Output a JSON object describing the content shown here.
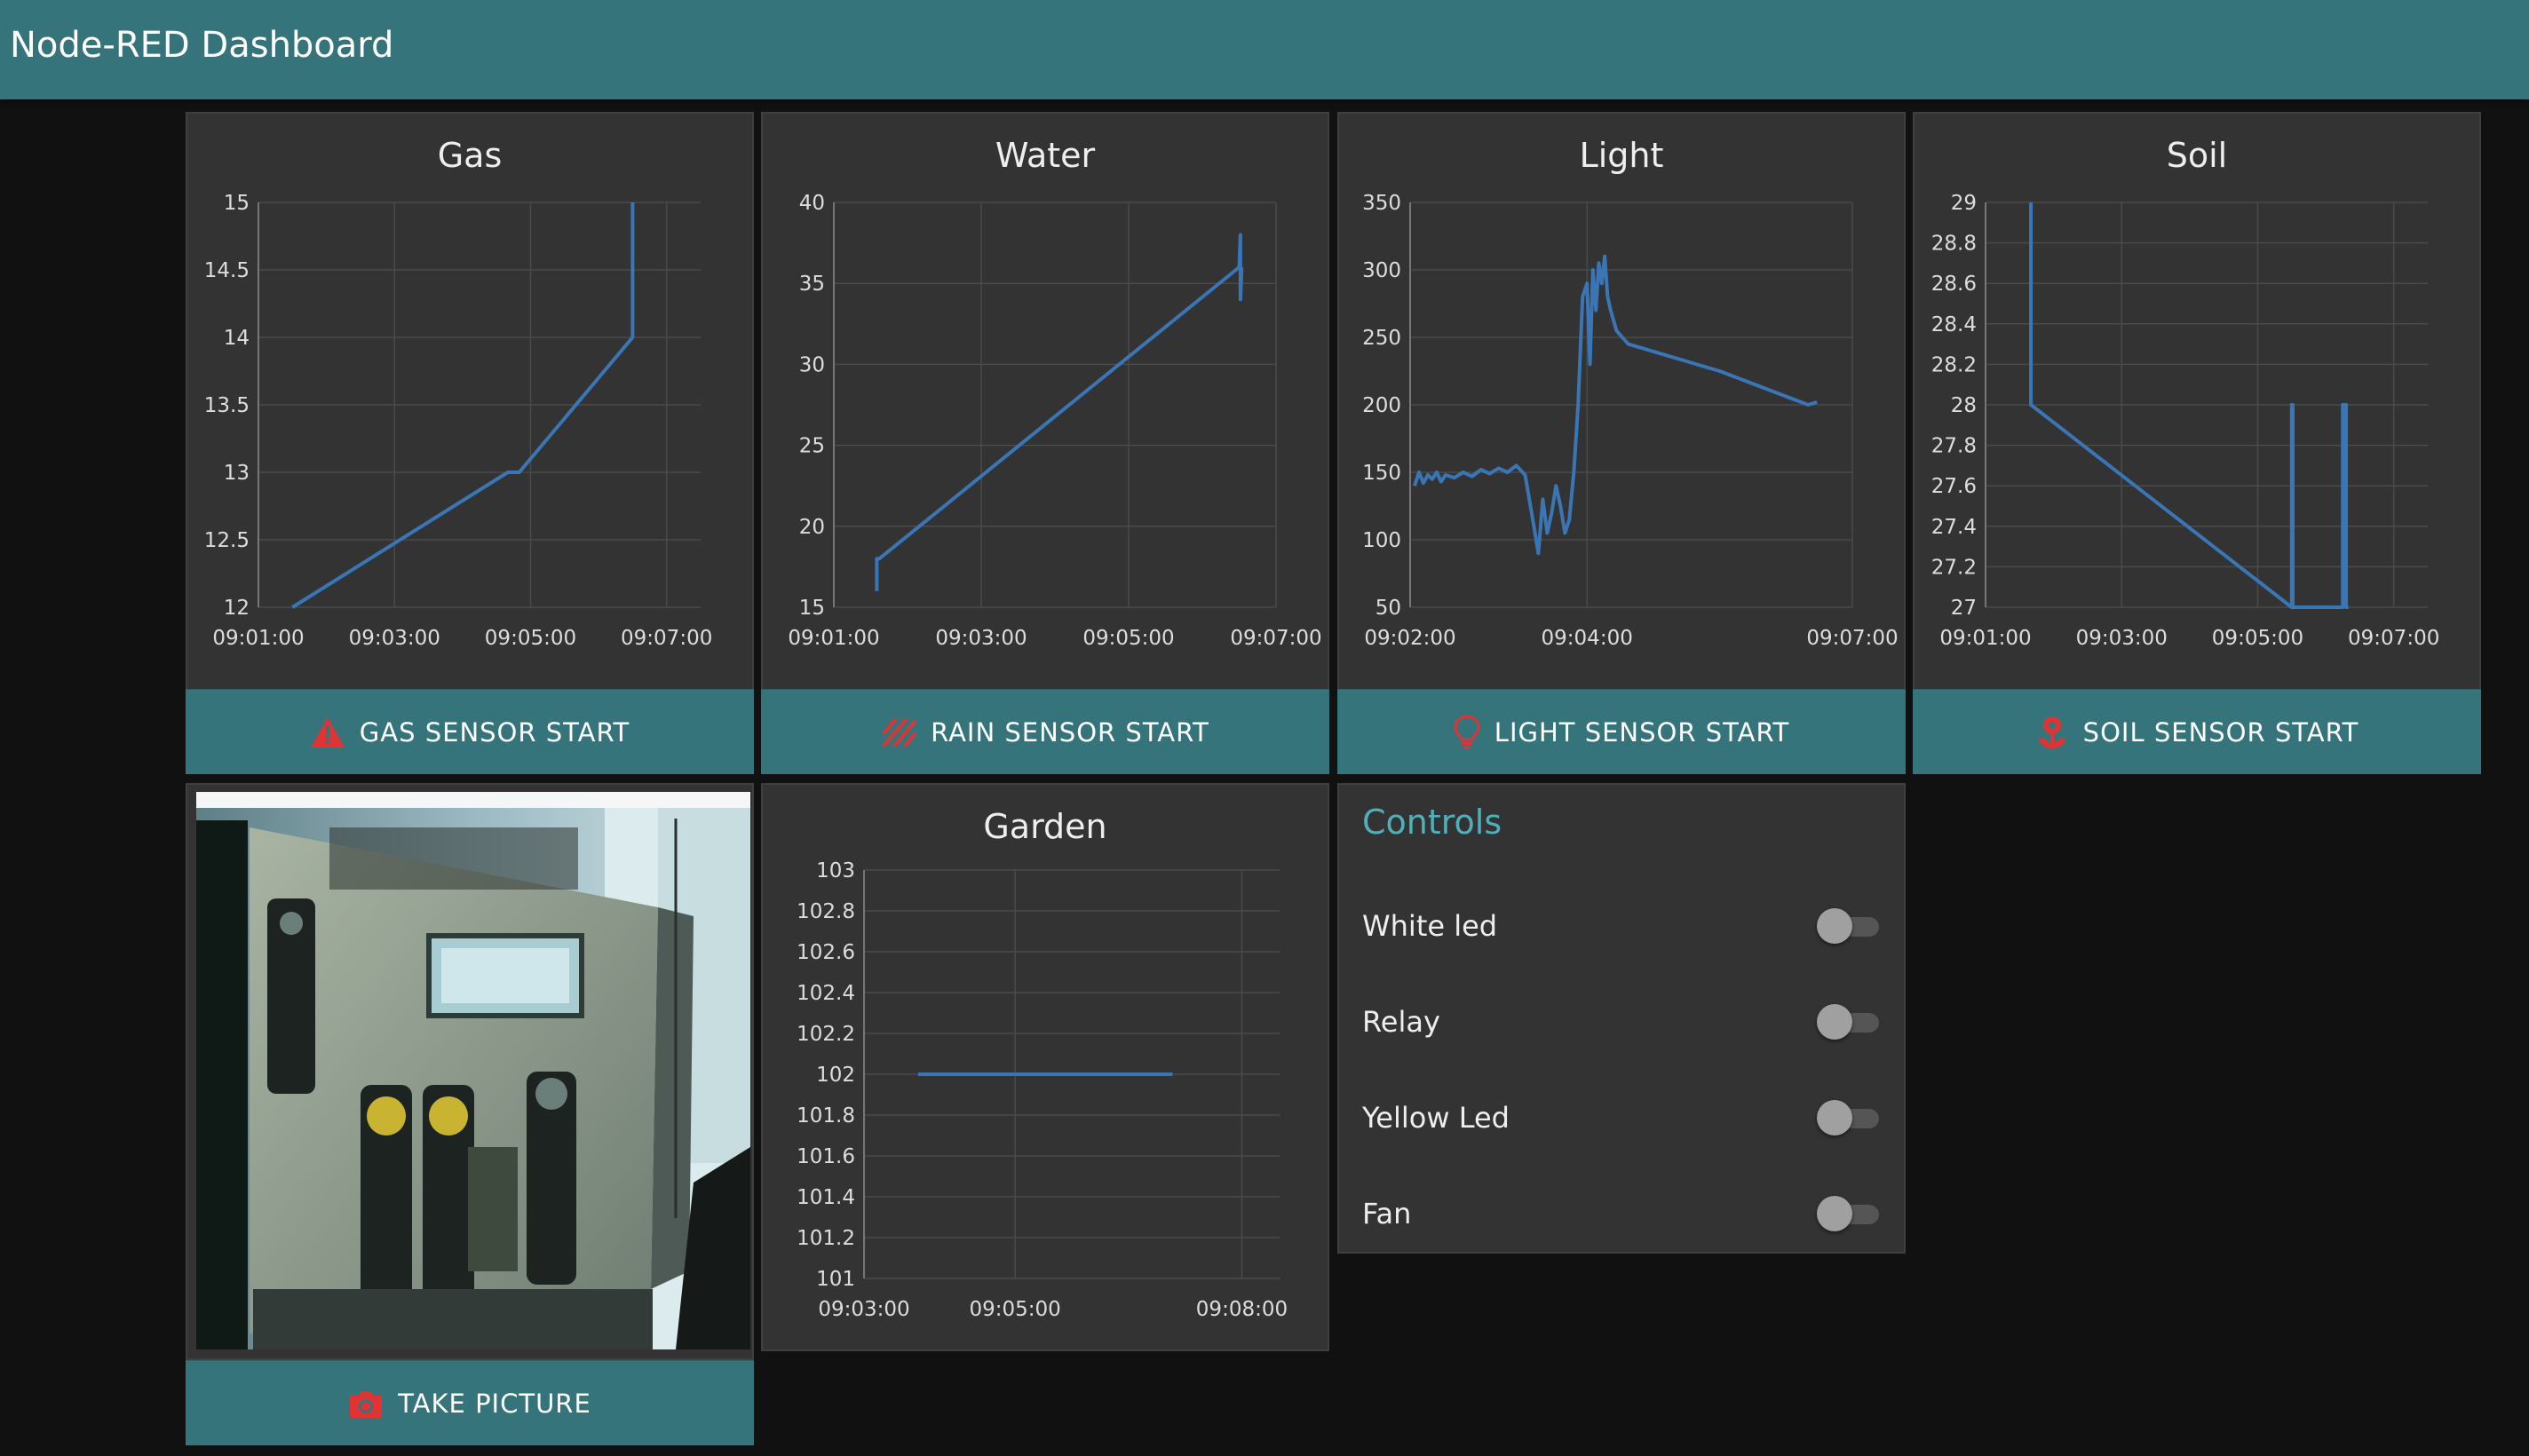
{
  "app": {
    "title": "Node-RED Dashboard"
  },
  "colors": {
    "header": "#35747b",
    "series": "#3a76b5",
    "accent_text": "#4fb0bb",
    "icon_red": "#e03434"
  },
  "buttons": {
    "gas": {
      "label": "GAS SENSOR START",
      "icon": "warning-triangle-icon"
    },
    "rain": {
      "label": "RAIN SENSOR START",
      "icon": "rain-icon"
    },
    "light": {
      "label": "LIGHT SENSOR START",
      "icon": "lightbulb-icon"
    },
    "soil": {
      "label": "SOIL SENSOR START",
      "icon": "plant-icon"
    },
    "picture": {
      "label": "TAKE PICTURE",
      "icon": "camera-icon"
    }
  },
  "camera": {
    "description_icon": "camera-image"
  },
  "controls": {
    "title": "Controls",
    "items": [
      {
        "label": "White led",
        "state": "off"
      },
      {
        "label": "Relay",
        "state": "off"
      },
      {
        "label": "Yellow Led",
        "state": "off"
      },
      {
        "label": "Fan",
        "state": "off"
      }
    ]
  },
  "chart_data": [
    {
      "id": "gas",
      "type": "line",
      "title": "Gas",
      "xlim": [
        "09:01:00",
        "09:07:30"
      ],
      "ylim": [
        12,
        15
      ],
      "x_ticks": [
        "09:01:00",
        "09:03:00",
        "09:05:00",
        "09:07:00"
      ],
      "y_ticks": [
        "15",
        "14.5",
        "14",
        "13.5",
        "13",
        "12.5",
        "12"
      ],
      "grid": true,
      "series": [
        {
          "x": [
            "09:01:30",
            "09:04:40",
            "09:04:50",
            "09:06:30",
            "09:06:30"
          ],
          "y": [
            12,
            13,
            13,
            14,
            15
          ]
        }
      ]
    },
    {
      "id": "water",
      "type": "line",
      "title": "Water",
      "xlim": [
        "09:01:00",
        "09:07:00"
      ],
      "ylim": [
        15,
        40
      ],
      "x_ticks": [
        "09:01:00",
        "09:03:00",
        "09:05:00",
        "09:07:00"
      ],
      "y_ticks": [
        "40",
        "35",
        "30",
        "25",
        "20",
        "15"
      ],
      "grid": true,
      "series": [
        {
          "x": [
            "09:01:35",
            "09:01:35",
            "09:01:37",
            "09:06:30",
            "09:06:31",
            "09:06:31",
            "09:06:32"
          ],
          "y": [
            16,
            18,
            18,
            36,
            38,
            34,
            36
          ]
        }
      ]
    },
    {
      "id": "light",
      "type": "line",
      "title": "Light",
      "xlim": [
        "09:02:00",
        "09:07:00"
      ],
      "ylim": [
        50,
        350
      ],
      "x_ticks": [
        "09:02:00",
        "09:04:00",
        "09:07:00"
      ],
      "y_ticks": [
        "350",
        "300",
        "250",
        "200",
        "150",
        "100",
        "50"
      ],
      "grid": true,
      "series": [
        {
          "x": [
            "09:02:03",
            "09:02:06",
            "09:02:09",
            "09:02:12",
            "09:02:15",
            "09:02:18",
            "09:02:21",
            "09:02:24",
            "09:02:30",
            "09:02:36",
            "09:02:42",
            "09:02:48",
            "09:02:54",
            "09:03:00",
            "09:03:06",
            "09:03:12",
            "09:03:18",
            "09:03:24",
            "09:03:27",
            "09:03:30",
            "09:03:33",
            "09:03:36",
            "09:03:39",
            "09:03:42",
            "09:03:45",
            "09:03:48",
            "09:03:51",
            "09:03:54",
            "09:03:57",
            "09:04:00",
            "09:04:02",
            "09:04:04",
            "09:04:06",
            "09:04:08",
            "09:04:10",
            "09:04:12",
            "09:04:14",
            "09:04:16",
            "09:04:20",
            "09:04:24",
            "09:04:28",
            "09:05:30",
            "09:06:30",
            "09:06:36"
          ],
          "y": [
            140,
            150,
            142,
            148,
            145,
            150,
            143,
            148,
            146,
            150,
            147,
            152,
            149,
            153,
            150,
            155,
            148,
            110,
            90,
            130,
            105,
            120,
            140,
            125,
            105,
            115,
            150,
            200,
            280,
            290,
            230,
            300,
            270,
            305,
            290,
            310,
            280,
            270,
            255,
            250,
            245,
            225,
            200,
            202
          ]
        }
      ]
    },
    {
      "id": "soil",
      "type": "line",
      "title": "Soil",
      "xlim": [
        "09:01:00",
        "09:07:30"
      ],
      "ylim": [
        27,
        29
      ],
      "x_ticks": [
        "09:01:00",
        "09:03:00",
        "09:05:00",
        "09:07:00"
      ],
      "y_ticks": [
        "29",
        "28.8",
        "28.6",
        "28.4",
        "28.2",
        "28",
        "27.8",
        "27.6",
        "27.4",
        "27.2",
        "27"
      ],
      "grid": true,
      "series": [
        {
          "x": [
            "09:01:40",
            "09:01:40",
            "09:05:30",
            "09:05:30",
            "09:05:31",
            "09:05:31",
            "09:06:15",
            "09:06:15",
            "09:06:18",
            "09:06:18",
            "09:06:20"
          ],
          "y": [
            29,
            28,
            27,
            28,
            28,
            27,
            27,
            28,
            28,
            27,
            27
          ]
        }
      ]
    },
    {
      "id": "garden",
      "type": "line",
      "title": "Garden",
      "xlim": [
        "09:03:00",
        "09:08:30"
      ],
      "ylim": [
        101,
        103
      ],
      "x_ticks": [
        "09:03:00",
        "09:05:00",
        "09:08:00"
      ],
      "y_ticks": [
        "103",
        "102.8",
        "102.6",
        "102.4",
        "102.2",
        "102",
        "101.8",
        "101.6",
        "101.4",
        "101.2",
        "101"
      ],
      "grid": true,
      "series": [
        {
          "x": [
            "09:03:43",
            "09:07:05"
          ],
          "y": [
            102,
            102
          ]
        }
      ]
    }
  ]
}
